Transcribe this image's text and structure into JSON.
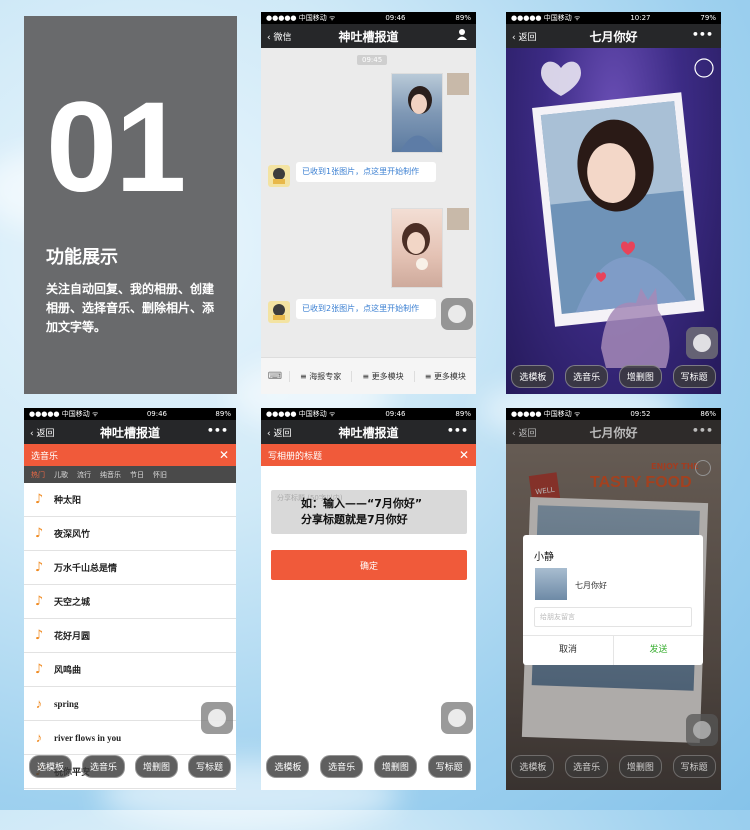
{
  "intro": {
    "number": "01",
    "title": "功能展示",
    "desc": "关注自动回复、我的相册、创建相册、选择音乐、删除相片、添加文字等。"
  },
  "status": {
    "carrier": "●●●●● 中国移动 ᯤ",
    "time_a": "09:46",
    "time_b": "10:27",
    "time_c": "09:52",
    "battery_a": "89%",
    "battery_b": "79%",
    "battery_c": "86%"
  },
  "chat": {
    "back": "微信",
    "title": "神吐槽报道",
    "timestamp": "09:45",
    "msg1": "已收到1张图片，点这里开始制作",
    "msg2": "已收到2张图片，点这里开始制作",
    "menu": [
      "海报专家",
      "更多模块",
      "更多模块"
    ]
  },
  "nav": {
    "back": "返回",
    "album_title": "七月你好",
    "more": "•••"
  },
  "toolbar": [
    "选模板",
    "选音乐",
    "增删图",
    "写标题"
  ],
  "music": {
    "bar_title": "选音乐",
    "categories": [
      "热门",
      "儿歌",
      "流行",
      "纯音乐",
      "节日",
      "怀旧"
    ],
    "songs": [
      "种太阳",
      "夜深风竹",
      "万水千山总是情",
      "天空之城",
      "花好月圆",
      "风鸣曲",
      "spring",
      "river flows in you",
      "祝你平安"
    ]
  },
  "titleedit": {
    "bar_title": "写相册的标题",
    "placeholder": "分享标题 (50字以内)",
    "hint": "如：输入——“7月你好”\n分享标题就是7月你好",
    "confirm": "确定"
  },
  "share": {
    "tag": "WELL",
    "subtitle": "ENJOY THE",
    "headline": "TASTY FOOD",
    "to": "小静",
    "album": "七月你好",
    "input_placeholder": "给朋友留言",
    "cancel": "取消",
    "send": "发送"
  },
  "colors": {
    "orange": "#f05a3a",
    "dark_nav": "#262729",
    "send_green": "#3cb034",
    "link_blue": "#3a7fd2"
  }
}
